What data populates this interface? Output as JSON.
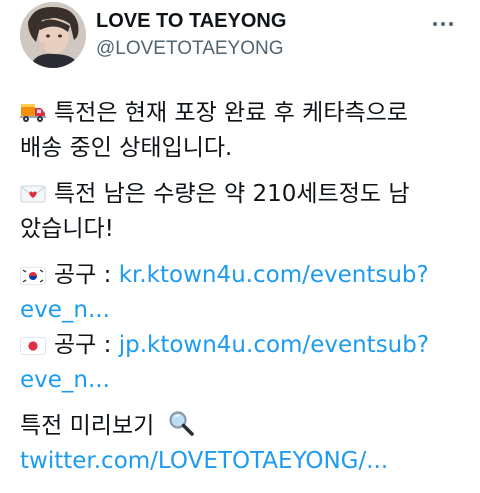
{
  "author": {
    "display_name": "LOVE TO TAEYONG",
    "handle": "@LOVETOTAEYONG"
  },
  "tweet": {
    "line1a": "특전은 현재 포장 완료 후 케타측으로",
    "line1b": "배송 중인 상태입니다.",
    "line2a": "특전 남은 수량은 약 210세트정도 남",
    "line2b": "았습니다!",
    "kr_label": "공구 : ",
    "kr_link_a": "kr.ktown4u.com/eventsub?",
    "kr_link_b": "eve_n...",
    "jp_label": "공구 : ",
    "jp_link_a": "jp.ktown4u.com/eventsub?",
    "jp_link_b": "eve_n...",
    "preview_label": "특전 미리보기",
    "twitter_link": "twitter.com/LOVETOTAEYONG/..."
  },
  "icons": {
    "truck": "delivery-truck-icon",
    "heart_letter": "love-letter-icon",
    "korea_flag": "south-korea-flag-icon",
    "japan_flag": "japan-flag-icon",
    "magnifier": "magnifying-glass-icon",
    "more": "more-options-icon"
  },
  "colors": {
    "link": "#1d9bf0",
    "secondary_text": "#536471",
    "primary_text": "#0f1419"
  }
}
